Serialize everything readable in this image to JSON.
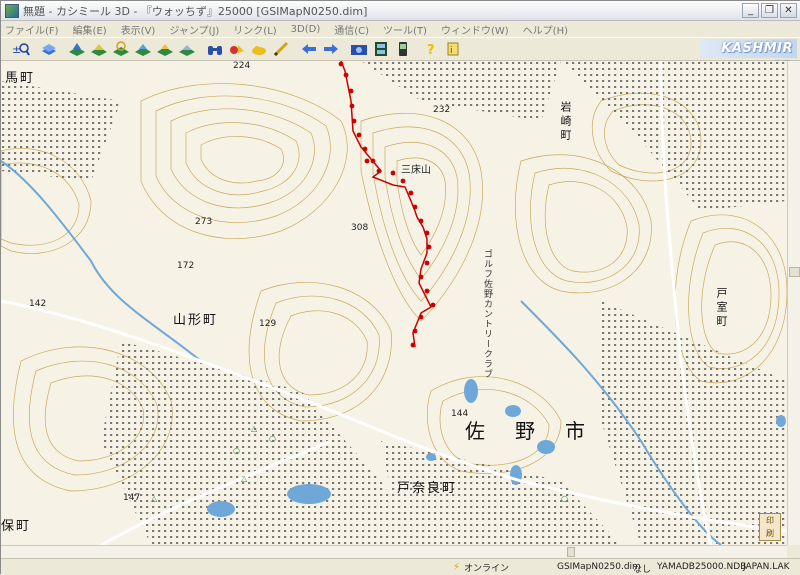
{
  "window": {
    "title": "無題 - カシミール 3D - 『ウォッちず』25000 [GSIMapN0250.dim]",
    "minimize": "_",
    "restore": "❐",
    "close": "✕"
  },
  "menu": [
    "ファイル(F)",
    "編集(E)",
    "表示(V)",
    "ジャンプ(J)",
    "リンク(L)",
    "3D(D)",
    "通信(C)",
    "ツール(T)",
    "ウィンドウ(W)",
    "ヘルプ(H)"
  ],
  "toolbar": {
    "icons": [
      "zoom-in-icon",
      "layer-icon",
      "map-view-1-icon",
      "map-view-2-icon",
      "map-view-3-icon",
      "map-view-4-icon",
      "map-view-5-icon",
      "map-view-6-icon",
      "binoculars-icon",
      "marker-icon",
      "cloud-icon",
      "pencil-icon",
      "back-arrow-icon",
      "forward-arrow-icon",
      "camera-icon",
      "film-icon",
      "gps-icon",
      "help-icon",
      "info-icon"
    ],
    "brand": "KASHMIR 3D"
  },
  "map": {
    "labels": {
      "town_yamagata": "山形町",
      "town_tonara": "戸奈良町",
      "town_iwasaki": "岩崎町",
      "town_tomuro": "戸室町",
      "city_sano": [
        "佐",
        "野",
        "市"
      ],
      "golf": "ゴルフ佐野カントリークラブ",
      "mt_label": "三床山",
      "ho": "保町",
      "uma": "馬町"
    },
    "spot_heights": [
      "224",
      "232",
      "273",
      "308",
      "129",
      "144",
      "147",
      "142",
      "172"
    ],
    "colors": {
      "land": "#f6f3e6",
      "contour": "#c8a95c",
      "urban": "#b9b9b9",
      "road": "#ffffff",
      "water": "#6fa8d8",
      "route": "#cc0000"
    }
  },
  "status": {
    "online": "オンライン",
    "map_file": "GSIMapN0250.dim",
    "none": "なし",
    "db_file": "YAMADB25000.NDB",
    "lak": "JAPAN.LAK"
  }
}
